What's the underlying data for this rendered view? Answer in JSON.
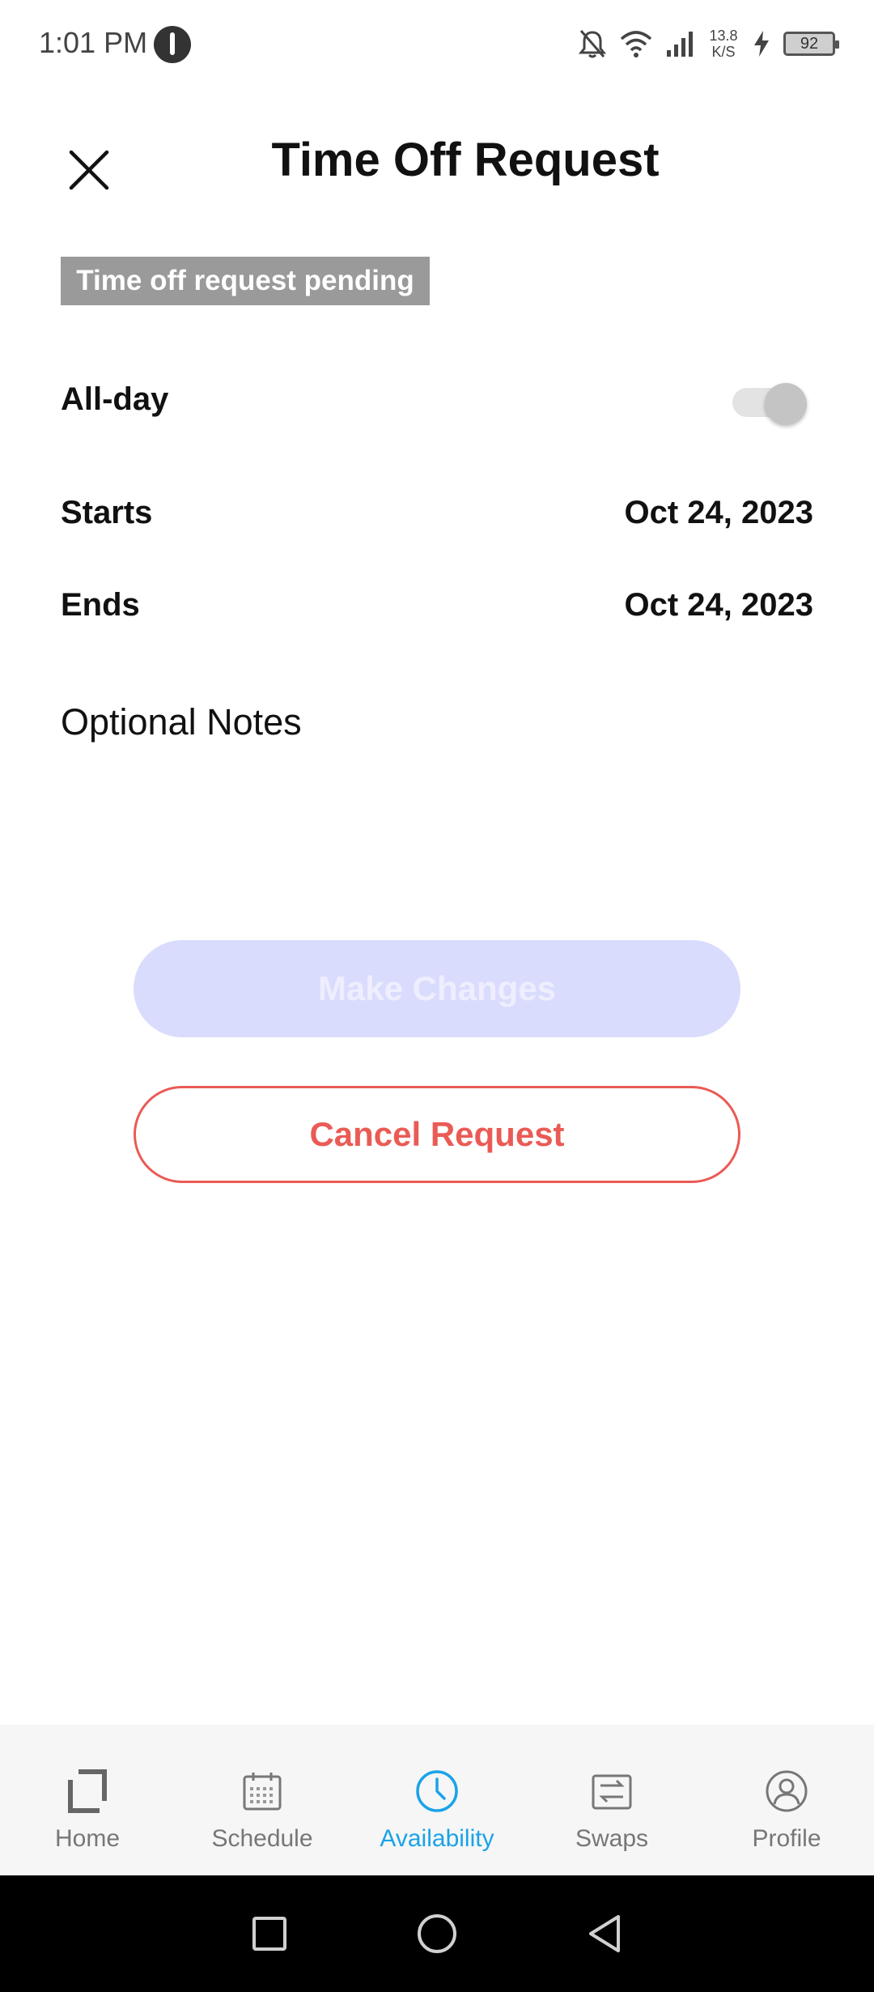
{
  "status_bar": {
    "time": "1:01 PM",
    "net_speed_value": "13.8",
    "net_speed_unit": "K/S",
    "battery": "92"
  },
  "header": {
    "title": "Time Off Request",
    "close_icon": "close-icon"
  },
  "status_badge": "Time off request pending",
  "form": {
    "all_day_label": "All-day",
    "all_day_on": false,
    "starts_label": "Starts",
    "starts_value": "Oct 24, 2023",
    "ends_label": "Ends",
    "ends_value": "Oct 24, 2023",
    "notes_label": "Optional Notes"
  },
  "actions": {
    "make_changes": "Make Changes",
    "cancel_request": "Cancel Request"
  },
  "bottom_nav": {
    "items": [
      {
        "label": "Home",
        "icon": "home-icon"
      },
      {
        "label": "Schedule",
        "icon": "calendar-icon"
      },
      {
        "label": "Availability",
        "icon": "clock-icon",
        "active": true
      },
      {
        "label": "Swaps",
        "icon": "swap-icon"
      },
      {
        "label": "Profile",
        "icon": "profile-icon"
      }
    ]
  },
  "colors": {
    "accent": "#1aa3e8",
    "danger": "#ea5b55",
    "disabled_button": "#dadcfd",
    "badge_bg": "#9a9a9a"
  }
}
